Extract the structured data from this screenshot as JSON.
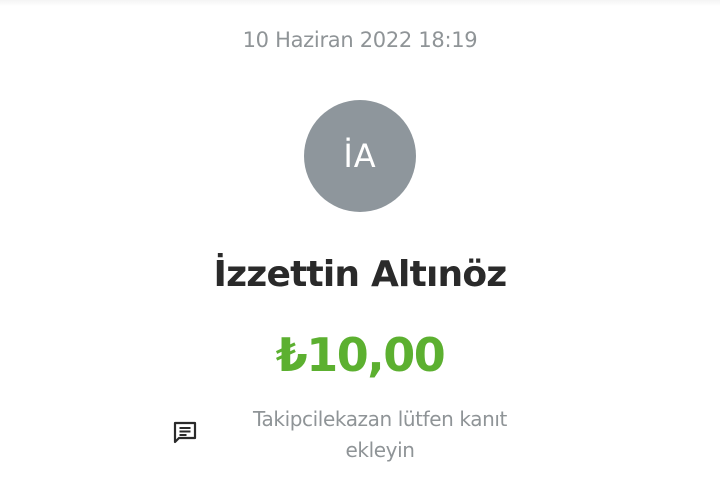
{
  "transaction": {
    "timestamp": "10 Haziran 2022 18:19",
    "avatar_initials": "İA",
    "name": "İzzettin Altınöz",
    "amount": "₺10,00",
    "note": "Takipcilekazan lütfen kanıt ekleyin"
  },
  "icons": {
    "note": "comment-icon"
  },
  "colors": {
    "amount": "#5cb030",
    "avatar_bg": "#8e969c",
    "muted_text": "#8f9497",
    "name_text": "#2a2a2a"
  }
}
